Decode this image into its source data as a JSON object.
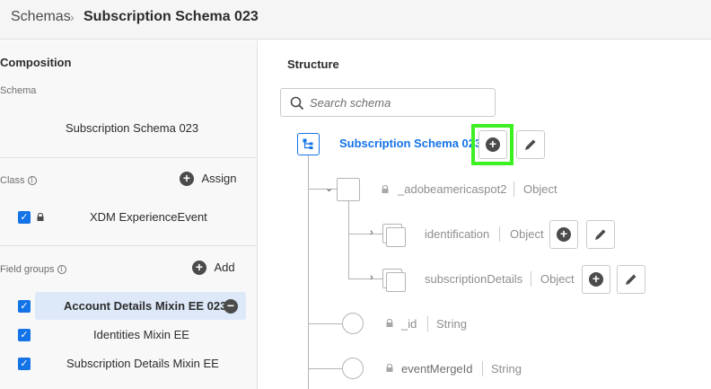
{
  "breadcrumb": {
    "root": "Schemas",
    "separator": "›",
    "current": "Subscription Schema 023"
  },
  "composition": {
    "heading": "Composition",
    "schema_label": "Schema",
    "schema_name": "Subscription Schema 023",
    "class_label": "Class",
    "class_info": "i",
    "assign_label": "Assign",
    "class_item": "XDM ExperienceEvent",
    "field_groups_label": "Field groups",
    "field_groups_info": "i",
    "add_label": "Add",
    "field_groups": [
      {
        "label": "Account Details Mixin EE 023",
        "checked": true,
        "selected": true
      },
      {
        "label": "Identities Mixin EE",
        "checked": true,
        "selected": false
      },
      {
        "label": "Subscription Details Mixin EE",
        "checked": true,
        "selected": false
      }
    ]
  },
  "structure": {
    "heading": "Structure",
    "search_placeholder": "Search schema",
    "root_name": "Subscription Schema 023",
    "nodes": [
      {
        "name": "_adobeamericaspot2",
        "type": "Object"
      },
      {
        "name": "identification",
        "type": "Object"
      },
      {
        "name": "subscriptionDetails",
        "type": "Object"
      },
      {
        "name": "_id",
        "type": "String"
      },
      {
        "name": "eventMergeId",
        "type": "String"
      }
    ]
  },
  "colors": {
    "accent": "#1473e6",
    "highlight": "#3cf021",
    "selected_row": "#dde9f8"
  },
  "icons": {
    "plus": "+",
    "minus": "−",
    "check": "✓",
    "chevron_right": "›",
    "chevron_down": "⌄"
  }
}
